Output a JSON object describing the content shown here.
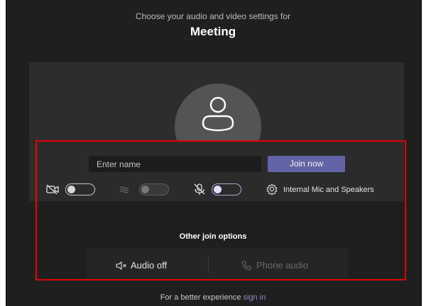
{
  "header": {
    "subtitle": "Choose your audio and video settings for",
    "title": "Meeting"
  },
  "name_input": {
    "placeholder": "Enter name",
    "value": ""
  },
  "join_button": {
    "label": "Join now",
    "color": "#6264a7"
  },
  "controls": {
    "camera": {
      "icon": "camera-off-icon",
      "toggle_state": "off"
    },
    "background": {
      "icon": "background-blur-icon",
      "toggle_state": "off",
      "enabled": false
    },
    "microphone": {
      "icon": "mic-off-icon",
      "toggle_state": "off"
    },
    "device_settings": {
      "icon": "gear-icon",
      "label": "Internal Mic and Speakers"
    }
  },
  "other_options": {
    "title": "Other join options",
    "audio_off": {
      "icon": "speaker-off-icon",
      "label": "Audio off"
    },
    "phone_audio": {
      "icon": "phone-icon",
      "label": "Phone audio",
      "enabled": false
    }
  },
  "footer": {
    "text": "For a better experience",
    "link": "sign in"
  },
  "colors": {
    "background": "#1f1f1f",
    "accent": "#6264a7",
    "highlight": "#e60000"
  }
}
